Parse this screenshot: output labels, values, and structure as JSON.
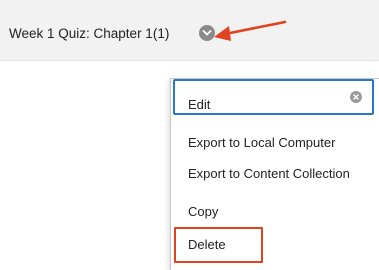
{
  "item": {
    "title": "Week 1 Quiz: Chapter 1(1)"
  },
  "menu": {
    "search": {
      "value": "",
      "placeholder": ""
    },
    "items": [
      {
        "label": "Edit"
      },
      {
        "label": "Export to Local Computer"
      },
      {
        "label": "Export to Content Collection"
      },
      {
        "label": "Copy"
      },
      {
        "label": "Delete"
      }
    ]
  },
  "colors": {
    "accent_focus": "#2a78c8",
    "annotation_red": "#e0431f",
    "header_bg": "#f2f2f2"
  },
  "icons": {
    "options": "chevron-down-icon",
    "clear": "clear-icon",
    "annotation": "red-arrow-icon"
  }
}
